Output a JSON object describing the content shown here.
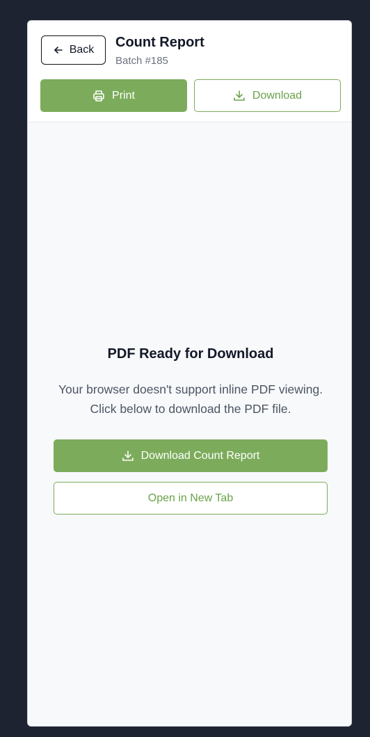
{
  "header": {
    "back_label": "Back",
    "title": "Count Report",
    "subtitle": "Batch #185",
    "print_label": "Print",
    "download_label": "Download"
  },
  "content": {
    "heading": "PDF Ready for Download",
    "message": "Your browser doesn't support inline PDF viewing. Click below to download the PDF file.",
    "download_report_label": "Download Count Report",
    "open_new_tab_label": "Open in New Tab"
  },
  "icons": {
    "back": "arrow-left-icon",
    "print": "printer-icon",
    "download": "download-icon"
  },
  "colors": {
    "accent": "#7cac5b",
    "background": "#1e2332",
    "content_bg": "#f8f9fb"
  }
}
